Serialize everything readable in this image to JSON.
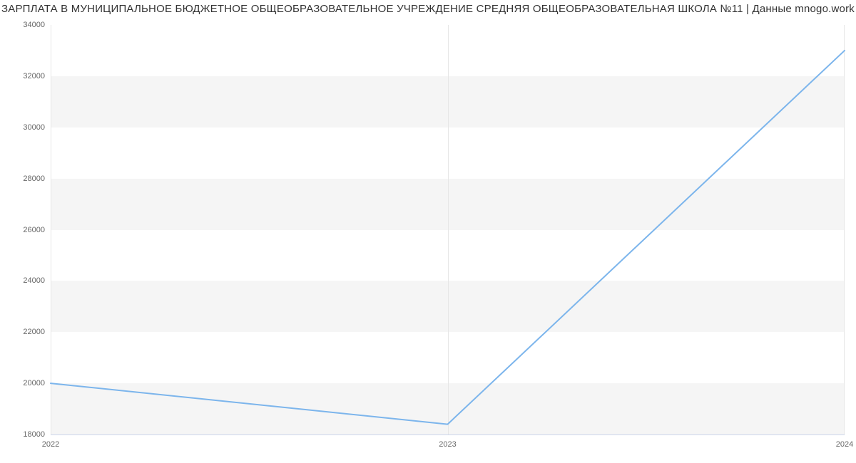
{
  "chart_data": {
    "type": "line",
    "title": "ЗАРПЛАТА В МУНИЦИПАЛЬНОЕ БЮДЖЕТНОЕ ОБЩЕОБРАЗОВАТЕЛЬНОЕ УЧРЕЖДЕНИЕ СРЕДНЯЯ ОБЩЕОБРАЗОВАТЕЛЬНАЯ ШКОЛА №11 | Данные mnogo.work",
    "x": [
      2022,
      2023,
      2024
    ],
    "values": [
      20000,
      18400,
      33000
    ],
    "xlabel": "",
    "ylabel": "",
    "xlim": [
      2022,
      2024
    ],
    "ylim": [
      18000,
      34000
    ],
    "y_ticks": [
      18000,
      20000,
      22000,
      24000,
      26000,
      28000,
      30000,
      32000,
      34000
    ],
    "x_ticks": [
      2022,
      2023,
      2024
    ],
    "line_color": "#7cb5ec",
    "band_color": "#f5f5f5"
  },
  "title": "ЗАРПЛАТА В МУНИЦИПАЛЬНОЕ БЮДЖЕТНОЕ ОБЩЕОБРАЗОВАТЕЛЬНОЕ УЧРЕЖДЕНИЕ СРЕДНЯЯ ОБЩЕОБРАЗОВАТЕЛЬНАЯ ШКОЛА №11 | Данные mnogo.work",
  "yticks": {
    "t0": "18000",
    "t1": "20000",
    "t2": "22000",
    "t3": "24000",
    "t4": "26000",
    "t5": "28000",
    "t6": "30000",
    "t7": "32000",
    "t8": "34000"
  },
  "xticks": {
    "t0": "2022",
    "t1": "2023",
    "t2": "2024"
  }
}
